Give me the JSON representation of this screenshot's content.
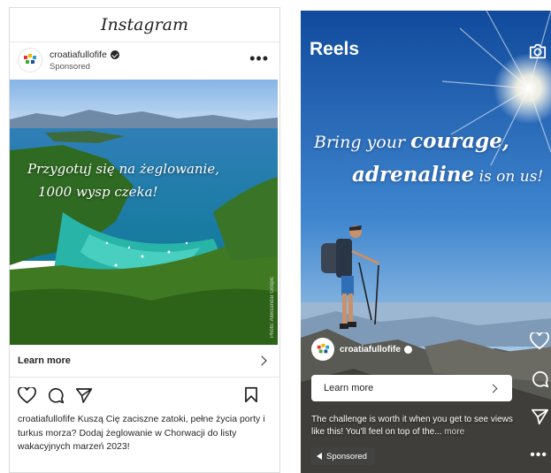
{
  "feed": {
    "app_title": "Instagram",
    "account": "croatiafullofife",
    "sponsored_label": "Sponsored",
    "more_label": "•••",
    "ad_text_line1": "Przygotuj się na żeglowanie,",
    "ad_text_line2": "1000 wysp czeka!",
    "photo_credit": "Photo: Aleksandar Gospic",
    "learn_more": "Learn more",
    "caption": "croatiafullofife Kuszą Cię zaciszne zatoki, pełne życia porty i turkus morza? Dodaj żeglowanie w Chorwacji do listy wakacyjnych marzeń 2023!"
  },
  "reels": {
    "title": "Reels",
    "headline_part1": "Bring your ",
    "headline_emph": "courage,",
    "headline_part2": "adrenaline",
    "headline_part3": " is on us!",
    "account": "croatiafullofife",
    "learn_more": "Learn more",
    "caption": "The challenge is worth it when you get to see views like this! You'll feel on top of the... ",
    "caption_more": "more",
    "sponsored_label": "Sponsored",
    "more_label": "•••"
  },
  "icons": {
    "verified": "verified-badge-icon",
    "heart": "heart-icon",
    "comment": "comment-icon",
    "share": "paper-plane-icon",
    "save": "bookmark-icon",
    "camera": "camera-icon",
    "chevron": "chevron-right-icon"
  },
  "colors": {
    "text_dark": "#262626",
    "sky_reels": "#1f5fb0",
    "sea": "#1a8aa8"
  }
}
